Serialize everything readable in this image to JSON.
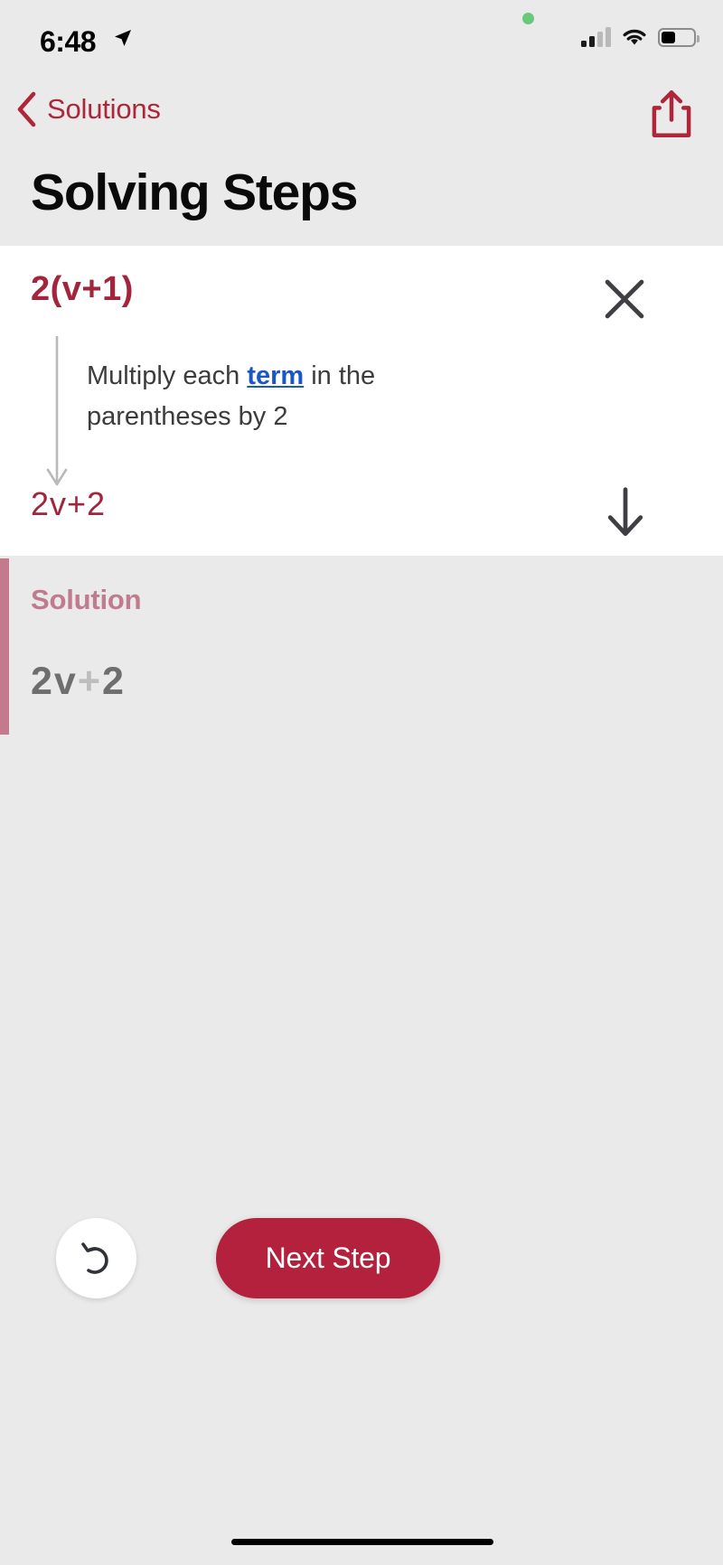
{
  "status_bar": {
    "time": "6:48",
    "location_icon": "location-arrow-icon",
    "signal_icon": "cellular-signal-icon",
    "wifi_icon": "wifi-icon",
    "battery_icon": "battery-icon",
    "privacy_indicator": "green-privacy-dot",
    "signal_bars_active": 2,
    "signal_bars_total": 4,
    "battery_level_percent": 40
  },
  "nav": {
    "back_label": "Solutions",
    "back_icon": "chevron-left-icon",
    "share_icon": "share-icon"
  },
  "header": {
    "title": "Solving Steps"
  },
  "step": {
    "expression": "2(v+1)",
    "close_icon": "close-x-icon",
    "flow_arrow_icon": "arrow-down-icon",
    "explanation_prefix": "Multiply each ",
    "explanation_link": "term",
    "explanation_suffix": " in the parentheses by 2",
    "result": "2v+2",
    "expand_icon": "arrow-down-icon"
  },
  "solution": {
    "label": "Solution",
    "expr_left": "2v",
    "expr_op": "+",
    "expr_right": "2"
  },
  "controls": {
    "undo_icon": "undo-arrow-icon",
    "next_label": "Next Step"
  },
  "colors": {
    "accent_crimson": "#a3253c",
    "button_crimson": "#b4213c",
    "link_blue": "#1a56c4",
    "solution_rose": "#c07b8d",
    "accent_bar_rose": "#c4798d",
    "page_background": "#eaeaea",
    "card_background": "#ffffff"
  },
  "home_indicator": "home-indicator-bar"
}
